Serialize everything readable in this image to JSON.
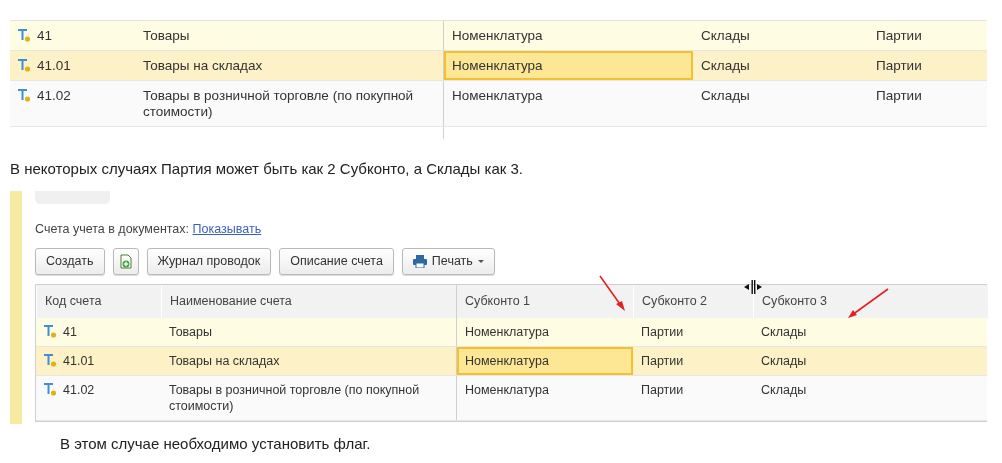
{
  "top_table": {
    "rows": [
      {
        "tinted": true,
        "selected": false,
        "cells": [
          {
            "text": "41",
            "focused": false
          },
          {
            "text": "Товары",
            "focused": false
          },
          {
            "text": "Номенклатура",
            "focused": false
          },
          {
            "text": "Склады",
            "focused": false
          },
          {
            "text": "Партии",
            "focused": false
          }
        ]
      },
      {
        "tinted": false,
        "selected": true,
        "cells": [
          {
            "text": "41.01",
            "focused": false
          },
          {
            "text": "Товары на складах",
            "focused": false
          },
          {
            "text": "Номенклатура",
            "focused": true
          },
          {
            "text": "Склады",
            "focused": false
          },
          {
            "text": "Партии",
            "focused": false
          }
        ]
      },
      {
        "tinted": false,
        "selected": false,
        "cells": [
          {
            "text": "41.02",
            "focused": false
          },
          {
            "text": "Товары в розничной торговле (по покупной стоимости)",
            "focused": false
          },
          {
            "text": "Номенклатура",
            "focused": false
          },
          {
            "text": "Склады",
            "focused": false
          },
          {
            "text": "Партии",
            "focused": false
          }
        ]
      }
    ]
  },
  "paragraph_1": "В некоторых случаях Партия может быть как 2 Субконто, а Склады как 3.",
  "second_screenshot": {
    "caption_label": "Счета учета в документах:",
    "caption_link": "Показывать",
    "toolbar": [
      {
        "kind": "text",
        "label": "Создать"
      },
      {
        "kind": "icon"
      },
      {
        "kind": "text",
        "label": "Журнал проводок"
      },
      {
        "kind": "text",
        "label": "Описание счета"
      },
      {
        "kind": "menu",
        "label": "Печать"
      }
    ],
    "columns": [
      "Код счета",
      "Наименование счета",
      "Субконто 1",
      "Субконто 2",
      "Субконто 3"
    ],
    "rows": [
      {
        "tinted": true,
        "selected": false,
        "cells": [
          {
            "text": "41",
            "focused": false
          },
          {
            "text": "Товары",
            "focused": false
          },
          {
            "text": "Номенклатура",
            "focused": false
          },
          {
            "text": "Партии",
            "focused": false
          },
          {
            "text": "Склады",
            "focused": false
          }
        ]
      },
      {
        "tinted": false,
        "selected": true,
        "cells": [
          {
            "text": "41.01",
            "focused": false
          },
          {
            "text": "Товары на складах",
            "focused": false
          },
          {
            "text": "Номенклатура",
            "focused": true
          },
          {
            "text": "Партии",
            "focused": false
          },
          {
            "text": "Склады",
            "focused": false
          }
        ]
      },
      {
        "tinted": false,
        "selected": false,
        "cells": [
          {
            "text": "41.02",
            "focused": false
          },
          {
            "text": "Товары в розничной торговле (по покупной стоимости)",
            "focused": false
          },
          {
            "text": "Номенклатура",
            "focused": false
          },
          {
            "text": "Партии",
            "focused": false
          },
          {
            "text": "Склады",
            "focused": false
          }
        ]
      }
    ]
  },
  "paragraph_2": "В этом случае необходимо установить флаг."
}
